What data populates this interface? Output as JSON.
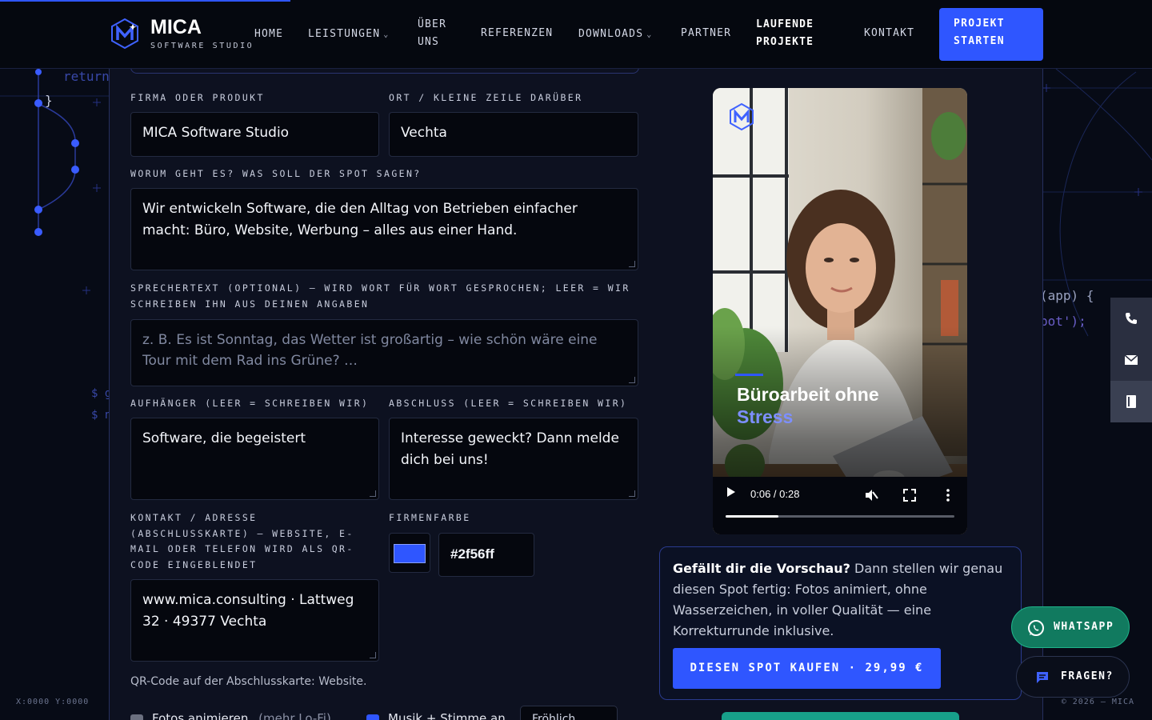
{
  "header": {
    "brand_name": "MICA",
    "brand_sub": "SOFTWARE STUDIO",
    "nav": {
      "home": "HOME",
      "leistungen": "LEISTUNGEN",
      "ueber_line1": "ÜBER",
      "ueber_line2": "UNS",
      "referenzen": "REFERENZEN",
      "downloads": "DOWNLOADS",
      "partner": "PARTNER",
      "laufende_line1": "LAUFENDE",
      "laufende_line2": "PROJEKTE",
      "kontakt": "KONTAKT"
    },
    "cta_line1": "PROJEKT",
    "cta_line2": "STARTEN"
  },
  "background": {
    "code_return": "return",
    "code_brace": "}",
    "code_app": "(app) {",
    "code_spot": "pot');",
    "code_dollar1": "$ g",
    "code_dollar2": "$ n",
    "coords": "X:0000 Y:0000",
    "copyright": "© 2026 — MICA"
  },
  "form": {
    "company_label": "FIRMA ODER PRODUKT",
    "company_value": "MICA Software Studio",
    "place_label": "ORT / KLEINE ZEILE DARÜBER",
    "place_value": "Vechta",
    "topic_label": "WORUM GEHT ES? WAS SOLL DER SPOT SAGEN?",
    "topic_value": "Wir entwickeln Software, die den Alltag von Betrieben einfacher macht: Büro, Website, Werbung – alles aus einer Hand.",
    "speaker_label_line1": "SPRECHERTEXT (OPTIONAL) — WIRD WORT FÜR WORT GESPROCHEN; LEER = WIR",
    "speaker_label_line2": "SCHREIBEN IHN AUS DEINEN ANGABEN",
    "speaker_placeholder": "z. B. Es ist Sonntag, das Wetter ist großartig – wie schön wäre eine Tour mit dem Rad ins Grüne? …",
    "hook_label": "AUFHÄNGER (LEER = SCHREIBEN WIR)",
    "hook_value": "Software, die begeistert",
    "close_label": "ABSCHLUSS (LEER = SCHREIBEN WIR)",
    "close_value": "Interesse geweckt? Dann melde dich bei uns!",
    "contact_label_line1": "KONTAKT / ADRESSE",
    "contact_label_line2": "(ABSCHLUSSKARTE) — WEBSITE, E-",
    "contact_label_line3": "MAIL ODER TELEFON WIRD ALS QR-",
    "contact_label_line4": "CODE EINGEBLENDET",
    "contact_value": "www.mica.consulting · Lattweg 32 · 49377 Vechta",
    "color_label": "FIRMENFARBE",
    "color_value": "#2f56ff",
    "qr_hint": "QR-Code auf der Abschlusskarte: Website.",
    "opt_photos": "Fotos animieren",
    "opt_photos_suffix": "(mehr Lo-Fi)",
    "opt_music": "Musik + Stimme an",
    "voice_select": "Fröhlich"
  },
  "video": {
    "title_line1": "Büroarbeit ohne",
    "title_line2": "Stress",
    "time": "0:06 / 0:28",
    "progress": 0.23
  },
  "buy": {
    "text_bold": "Gefällt dir die Vorschau?",
    "text_rest": " Dann stellen wir genau diesen Spot fertig: Fotos animiert, ohne Wasserzeichen, in voller Qualität — eine Korrekturrunde inklusive.",
    "button": "DIESEN SPOT KAUFEN · 29,99 €"
  },
  "floating": {
    "whatsapp": "WHATSAPP",
    "ask": "FRAGEN?"
  },
  "colors": {
    "accent": "#2f56ff",
    "whatsapp": "#117a5f",
    "background": "#070b16"
  }
}
